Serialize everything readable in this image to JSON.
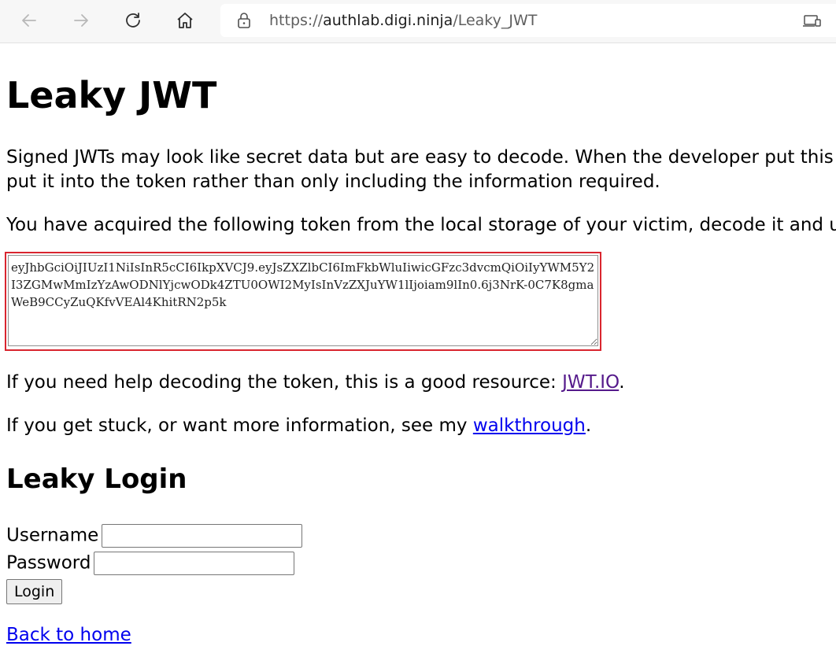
{
  "browser": {
    "url_prefix": "https://",
    "url_host": "authlab.digi.ninja",
    "url_path": "/Leaky_JWT"
  },
  "page": {
    "title": "Leaky JWT",
    "intro_line1": "Signed JWTs may look like secret data but are easy to decode. When the developer put this",
    "intro_line2": "put it into the token rather than only including the information required.",
    "acquired_text": "You have acquired the following token from the local storage of your victim, decode it and u",
    "token": "eyJhbGciOiJIUzI1NiIsInR5cCI6IkpXVCJ9.eyJsZXZlbCI6ImFkbWluIiwicGFzc3dvcmQiOiIyYWM5Y2I3ZGMwMmIzYzAwODNlYjcwODk4ZTU0OWI2MyIsInVzZXJuYW1lIjoiam9lIn0.6j3NrK-0C7K8gmaWeB9CCyZuQKfvVEAl4KhitRN2p5k",
    "help_text": "If you need help decoding the token, this is a good resource: ",
    "help_link": "JWT.IO",
    "help_suffix": ".",
    "stuck_text": "If you get stuck, or want more information, see my ",
    "stuck_link": "walkthrough",
    "stuck_suffix": "."
  },
  "login": {
    "heading": "Leaky Login",
    "username_label": "Username",
    "password_label": "Password",
    "button_label": "Login"
  },
  "footer": {
    "back_link": "Back to home"
  },
  "colors": {
    "highlight_border": "#d9252f",
    "link": "#0000ee",
    "visited_link": "#551a8b"
  }
}
